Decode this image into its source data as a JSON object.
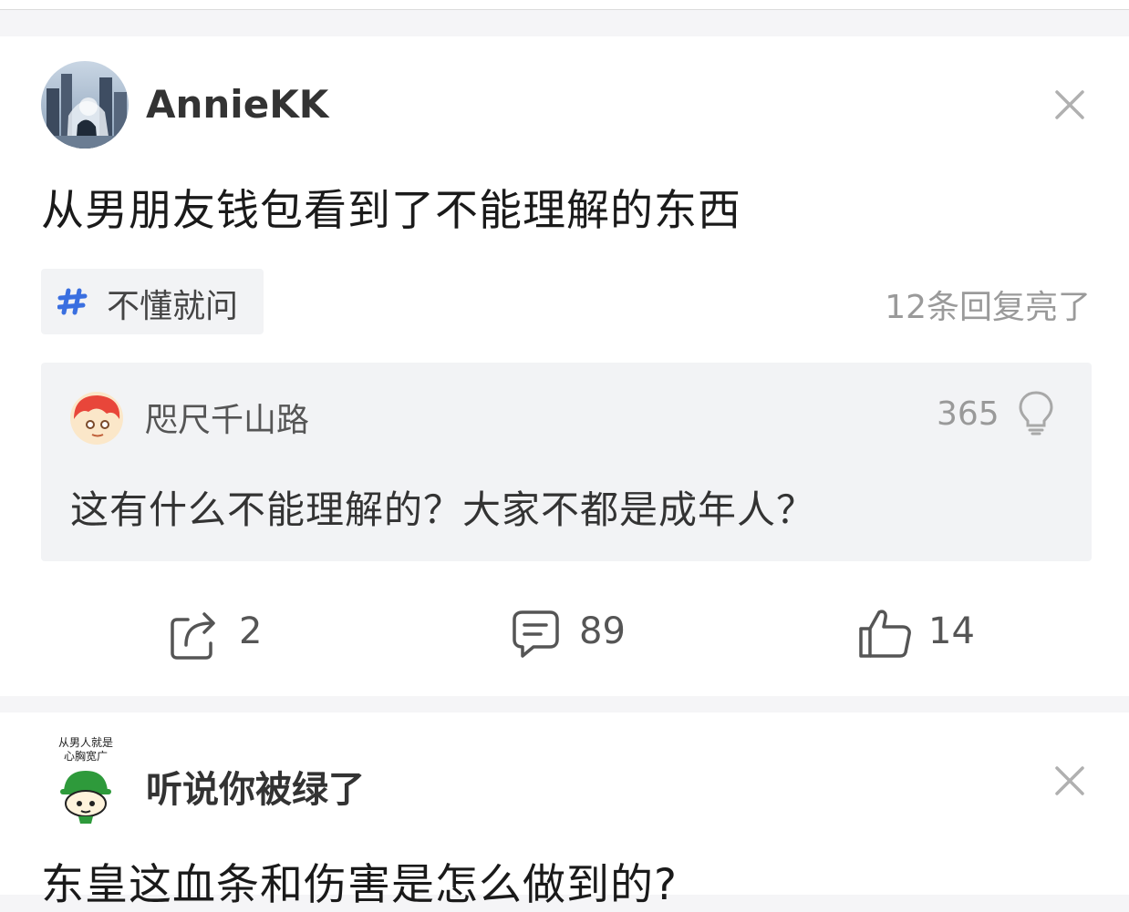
{
  "post": {
    "author": "AnnieKK",
    "title": "从男朋友钱包看到了不能理解的东西",
    "topic_label": "不懂就问",
    "reply_status": "12条回复亮了",
    "top_comment": {
      "author": "咫尺千山路",
      "likes": "365",
      "text": "这有什么不能理解的？大家不都是成年人？"
    },
    "actions": {
      "share_count": "2",
      "comment_count": "89",
      "like_count": "14"
    }
  },
  "next_post": {
    "author": "听说你被绿了",
    "avatar_caption_line1": "从男人就是",
    "avatar_caption_line2": "心胸宽广",
    "title": "东皇这血条和伤害是怎么做到的?"
  },
  "colors": {
    "topic_icon": "#3a6fe0",
    "hat_green": "#2e9a3b",
    "muted_text": "#9a9a9a",
    "card_gray": "#f2f3f5"
  },
  "icons": [
    "close-icon",
    "topic-hash-icon",
    "lightbulb-icon",
    "share-icon",
    "comment-icon",
    "thumbs-up-icon"
  ]
}
